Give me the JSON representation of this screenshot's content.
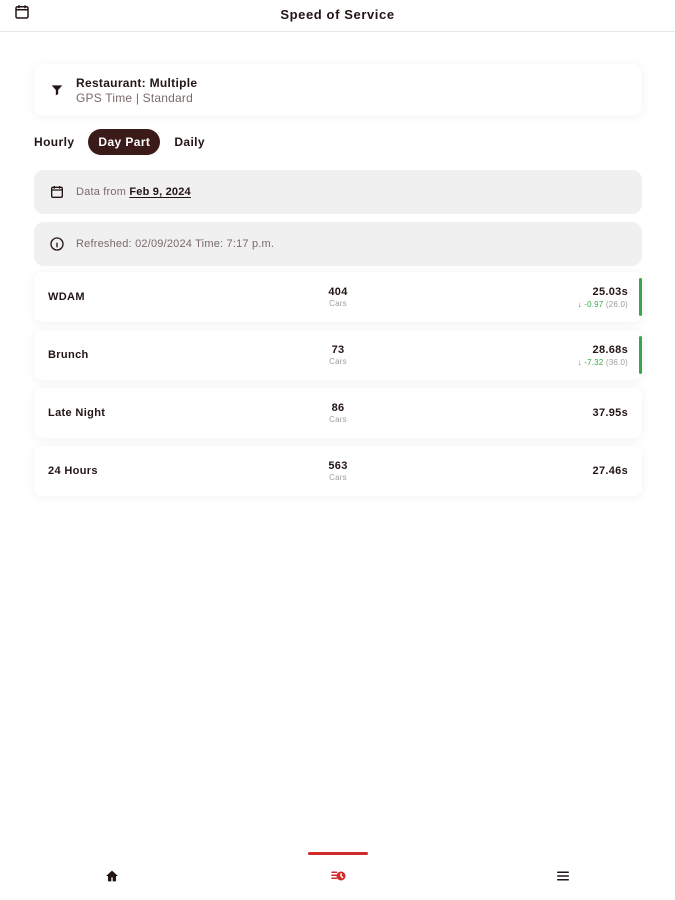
{
  "app": {
    "title": "Speed of Service"
  },
  "filter": {
    "line1": "Restaurant: Multiple",
    "line2": "GPS Time | Standard"
  },
  "tabs": [
    {
      "label": "Hourly"
    },
    {
      "label": "Day Part"
    },
    {
      "label": "Daily"
    }
  ],
  "data_from": {
    "prefix": "Data from",
    "date": "Feb 9, 2024"
  },
  "refreshed": {
    "text": "Refreshed: 02/09/2024 Time: 7:17 p.m."
  },
  "rows": [
    {
      "name": "WDAM",
      "count": "404",
      "count_label": "Cars",
      "time": "25.03s",
      "delta": "↓ -0.97",
      "goal": "(26.0)"
    },
    {
      "name": "Brunch",
      "count": "73",
      "count_label": "Cars",
      "time": "28.68s",
      "delta": "↓ -7.32",
      "goal": "(36.0)"
    },
    {
      "name": "Late Night",
      "count": "86",
      "count_label": "Cars",
      "time": "37.95s"
    },
    {
      "name": "24 Hours",
      "count": "563",
      "count_label": "Cars",
      "time": "27.46s"
    }
  ],
  "icons": {
    "calendar": "calendar-icon",
    "filter": "filter-icon",
    "info": "info-icon",
    "home": "home-icon",
    "sos": "speed-of-service-icon",
    "menu": "menu-icon"
  },
  "colors": {
    "brand": "#3b1a1a",
    "accent": "#d12a2a",
    "positive": "#3aa64a"
  },
  "ui_state": {
    "active_tab": "Day Part",
    "active_nav": "speed-of-service"
  }
}
